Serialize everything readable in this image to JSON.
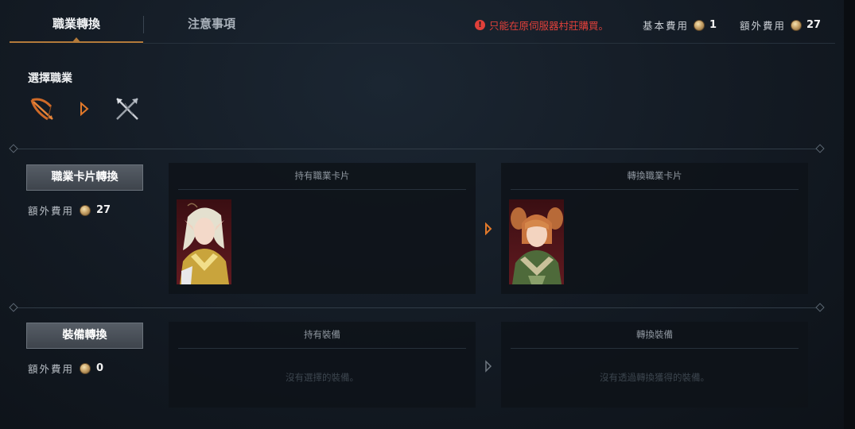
{
  "tabs": [
    {
      "label": "職業轉換",
      "active": true
    },
    {
      "label": "注意事項",
      "active": false
    }
  ],
  "header": {
    "warning": "只能在原伺服器村莊購買。",
    "base_fee_label": "基本費用",
    "base_fee_value": "1",
    "extra_fee_label": "額外費用",
    "extra_fee_value": "27"
  },
  "select_class": {
    "title": "選擇職業",
    "from_icon": "crossbow-icon",
    "to_icon": "crossed-blades-icon"
  },
  "class_card_section": {
    "button_label": "職業卡片轉換",
    "fee_label": "額外費用",
    "fee_value": "27",
    "owned_title": "持有職業卡片",
    "converted_title": "轉換職業卡片"
  },
  "equipment_section": {
    "button_label": "裝備轉換",
    "fee_label": "額外費用",
    "fee_value": "0",
    "owned_title": "持有裝備",
    "owned_empty": "沒有選擇的裝備。",
    "converted_title": "轉換裝備",
    "converted_empty": "沒有透過轉換獲得的裝備。"
  },
  "colors": {
    "accent": "#b37a3a",
    "warning": "#e0403a",
    "arrow": "#e0782a"
  }
}
